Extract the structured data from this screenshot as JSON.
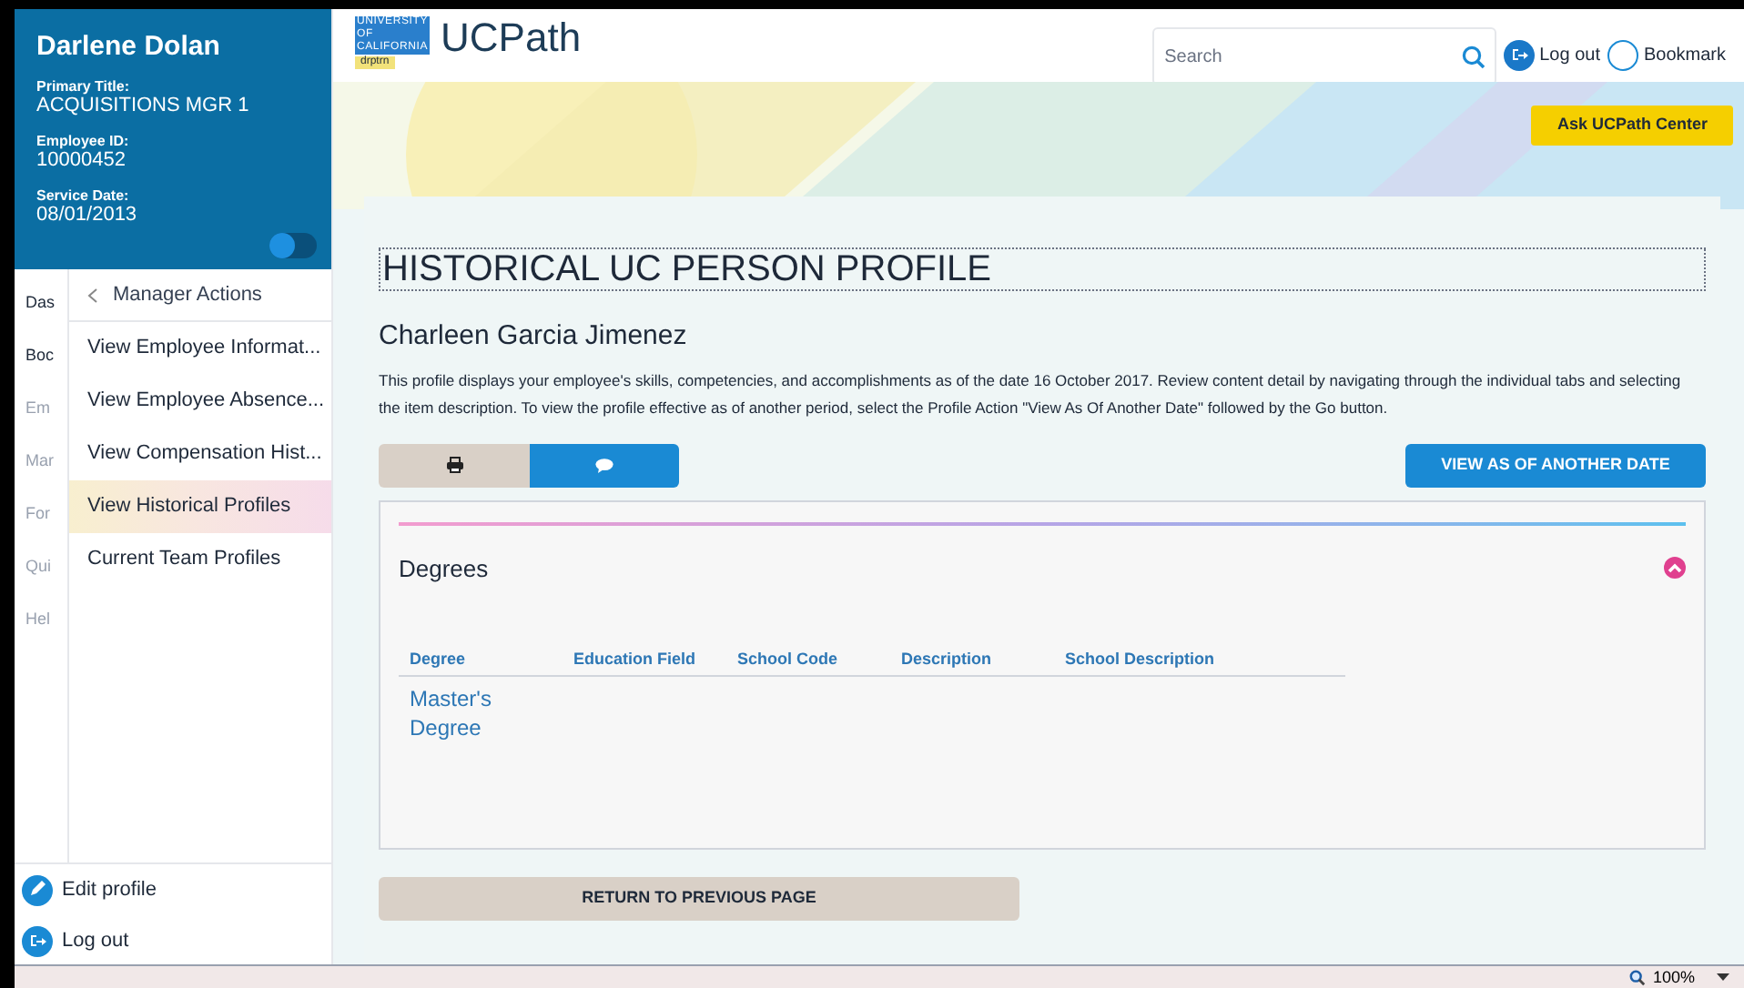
{
  "profile_card": {
    "name": "Darlene Dolan",
    "fields": [
      {
        "label": "Primary Title:",
        "value": "ACQUISITIONS MGR 1"
      },
      {
        "label": "Employee ID:",
        "value": "10000452"
      },
      {
        "label": "Service Date:",
        "value": "08/01/2013"
      }
    ],
    "toggle_on": false
  },
  "sidebar": {
    "items": [
      {
        "label": "Das",
        "disabled": false
      },
      {
        "label": "Boc",
        "disabled": false
      },
      {
        "label": "Em",
        "disabled": true
      },
      {
        "label": "Mar",
        "disabled": true
      },
      {
        "label": "For",
        "disabled": true
      },
      {
        "label": "Qui",
        "disabled": true
      },
      {
        "label": "Hel",
        "disabled": true
      }
    ],
    "footer": [
      "Edit profile",
      "Log out"
    ]
  },
  "submenu": {
    "title": "Manager Actions",
    "items": [
      {
        "label": "View Employee Informat...",
        "selected": false
      },
      {
        "label": "View Employee Absence...",
        "selected": false
      },
      {
        "label": "View Compensation Hist...",
        "selected": false
      },
      {
        "label": "View Historical Profiles",
        "selected": true
      },
      {
        "label": "Current Team Profiles",
        "selected": false
      }
    ]
  },
  "header": {
    "logo_lines": [
      "UNIVERSITY",
      "OF",
      "CALIFORNIA"
    ],
    "env_tag": "drptrn",
    "app_name": "UCPath",
    "search": {
      "placeholder": "Search"
    },
    "logout": "Log out",
    "bookmark": "Bookmark",
    "help_button": "Ask UCPath Center"
  },
  "page": {
    "title": "HISTORICAL UC PERSON PROFILE",
    "person": "Charleen Garcia Jimenez",
    "description": "This profile displays your employee's skills, competencies, and accomplishments as of the date 16 October 2017. Review content detail by navigating through the individual tabs and selecting the item description. To view the profile effective as of another period, select the Profile Action \"View As Of Another Date\" followed by the Go button.",
    "view_button": "VIEW AS OF ANOTHER DATE",
    "section": {
      "title": "Degrees",
      "expanded": true,
      "table": {
        "columns": [
          "Degree",
          "Education Field",
          "School Code",
          "Description",
          "School Description"
        ],
        "rows": [
          [
            "Master's Degree"
          ]
        ]
      }
    },
    "return_button": "RETURN TO PREVIOUS PAGE"
  },
  "status_bar": {
    "zoom": "100%"
  }
}
